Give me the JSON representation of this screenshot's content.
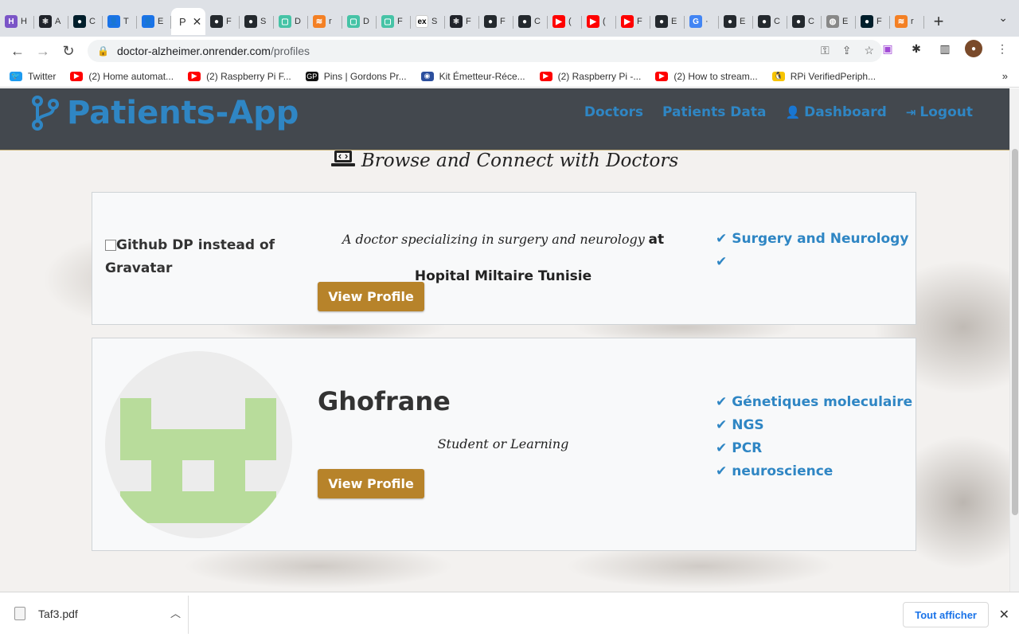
{
  "browser": {
    "tabs": [
      {
        "icon": "h-icon",
        "color": "#7b55c7",
        "glyph": "H",
        "title": "H"
      },
      {
        "icon": "react-icon",
        "color": "#20232a",
        "glyph": "⚛",
        "title": "A"
      },
      {
        "icon": "mongodb-icon",
        "color": "#001e2b",
        "glyph": "●",
        "title": "C"
      },
      {
        "icon": "contacts-icon",
        "color": "#1a73e8",
        "glyph": "👤",
        "title": "T"
      },
      {
        "icon": "contacts-icon",
        "color": "#1a73e8",
        "glyph": "👤",
        "title": "E"
      },
      {
        "icon": "github-icon",
        "color": "#24292e",
        "glyph": "●",
        "title": "F"
      },
      {
        "icon": "github-icon",
        "color": "#24292e",
        "glyph": "●",
        "title": "S"
      },
      {
        "icon": "render-icon",
        "color": "#46c3a6",
        "glyph": "▢",
        "title": "D"
      },
      {
        "icon": "stackoverflow-icon",
        "color": "#f48024",
        "glyph": "≋",
        "title": "r"
      },
      {
        "icon": "render-icon",
        "color": "#46c3a6",
        "glyph": "▢",
        "title": "D"
      },
      {
        "icon": "render-icon",
        "color": "#46c3a6",
        "glyph": "▢",
        "title": "F"
      },
      {
        "icon": "express-icon",
        "color": "#ffffff",
        "glyph": "ex",
        "title": "S"
      },
      {
        "icon": "react-icon",
        "color": "#20232a",
        "glyph": "⚛",
        "title": "F"
      },
      {
        "icon": "github-icon",
        "color": "#24292e",
        "glyph": "●",
        "title": "F"
      },
      {
        "icon": "github-icon",
        "color": "#24292e",
        "glyph": "●",
        "title": "C"
      },
      {
        "icon": "youtube-icon",
        "color": "#ff0000",
        "glyph": "▶",
        "title": "("
      },
      {
        "icon": "youtube-icon",
        "color": "#ff0000",
        "glyph": "▶",
        "title": "("
      },
      {
        "icon": "youtube-icon",
        "color": "#ff0000",
        "glyph": "▶",
        "title": "F"
      },
      {
        "icon": "github-icon",
        "color": "#24292e",
        "glyph": "●",
        "title": "E"
      },
      {
        "icon": "google-icon",
        "color": "#4285f4",
        "glyph": "G",
        "title": "·"
      },
      {
        "icon": "github-icon",
        "color": "#24292e",
        "glyph": "●",
        "title": "E"
      },
      {
        "icon": "github-icon",
        "color": "#24292e",
        "glyph": "●",
        "title": "C"
      },
      {
        "icon": "github-icon",
        "color": "#24292e",
        "glyph": "●",
        "title": "C"
      },
      {
        "icon": "globe-icon",
        "color": "#888888",
        "glyph": "◍",
        "title": "E"
      },
      {
        "icon": "mongodb-icon",
        "color": "#001e2b",
        "glyph": "●",
        "title": "F"
      },
      {
        "icon": "stackoverflow-icon",
        "color": "#f48024",
        "glyph": "≋",
        "title": "r"
      }
    ],
    "active_tab": {
      "glyph": "P",
      "close": "✕"
    },
    "new_tab": "+",
    "url_host": "doctor-alzheimer.onrender.com",
    "url_path": "/profiles",
    "bookmarks": [
      {
        "icon": "twitter-icon",
        "color": "#1d9bf0",
        "glyph": "🐦",
        "label": "Twitter"
      },
      {
        "icon": "youtube-icon",
        "color": "#ff0000",
        "glyph": "▶",
        "label": "(2) Home automat..."
      },
      {
        "icon": "youtube-icon",
        "color": "#ff0000",
        "glyph": "▶",
        "label": "(2) Raspberry Pi F..."
      },
      {
        "icon": "gp-icon",
        "color": "#111111",
        "glyph": "GP",
        "label": "Pins | Gordons Pr..."
      },
      {
        "icon": "kit-icon",
        "color": "#2c4f9e",
        "glyph": "◉",
        "label": "Kit Émetteur-Réce..."
      },
      {
        "icon": "youtube-icon",
        "color": "#ff0000",
        "glyph": "▶",
        "label": "(2) Raspberry Pi -..."
      },
      {
        "icon": "youtube-icon",
        "color": "#ff0000",
        "glyph": "▶",
        "label": "(2) How to stream..."
      },
      {
        "icon": "linux-icon",
        "color": "#f7c400",
        "glyph": "🐧",
        "label": "RPi VerifiedPeriph..."
      }
    ],
    "bookmarks_more": "»"
  },
  "app": {
    "brand": "Patients-App",
    "nav": [
      {
        "label": "Doctors",
        "icon": ""
      },
      {
        "label": "Patients Data",
        "icon": ""
      },
      {
        "label": "Dashboard",
        "icon": "user-icon"
      },
      {
        "label": "Logout",
        "icon": "logout-icon"
      }
    ],
    "lead": "Browse and Connect with Doctors",
    "profiles": [
      {
        "img_alt": "Github DP instead of Gravatar",
        "bio_italic": "A doctor specializing in surgery and neurology",
        "bio_bold": "at Hopital Miltaire Tunisie",
        "button": "View Profile",
        "skills": [
          "Surgery and Neurology",
          ""
        ]
      },
      {
        "name": "Ghofrane",
        "bio_italic": "Student or Learning",
        "button": "View Profile",
        "skills": [
          "Génetiques moleculaire",
          "NGS",
          "PCR",
          "neuroscience"
        ]
      }
    ],
    "colors": {
      "link": "#2f86c4",
      "button": "#b7832a",
      "navbar": "#343a40",
      "identicon": "#b8dc9b"
    }
  },
  "downloads": {
    "file": "Taf3.pdf",
    "show_all": "Tout afficher",
    "close": "✕"
  }
}
